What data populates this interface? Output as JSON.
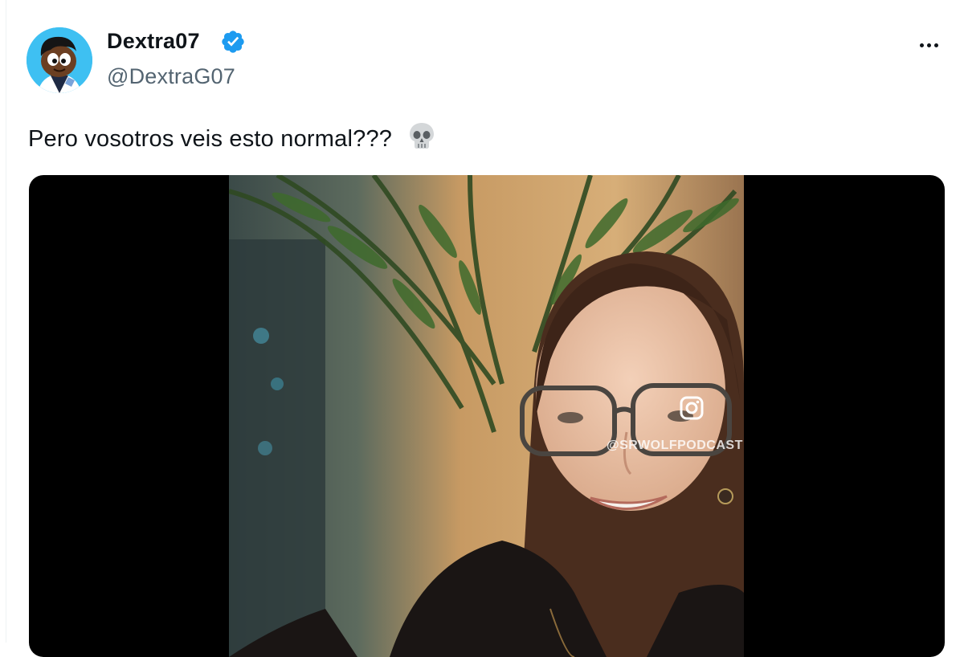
{
  "author": {
    "display_name": "Dextra07",
    "handle": "@DextraG07",
    "verified": true
  },
  "tweet": {
    "text": "Pero vosotros veis esto normal???",
    "emoji": "skull"
  },
  "media": {
    "kind": "video",
    "watermark": "@SRWOLFPODCAST"
  },
  "icons": {
    "verified": "verified-badge-icon",
    "more": "more-options-icon",
    "instagram": "instagram-icon"
  },
  "colors": {
    "verified_blue": "#1d9bf0",
    "text_primary": "#0f1419",
    "text_secondary": "#536471"
  }
}
